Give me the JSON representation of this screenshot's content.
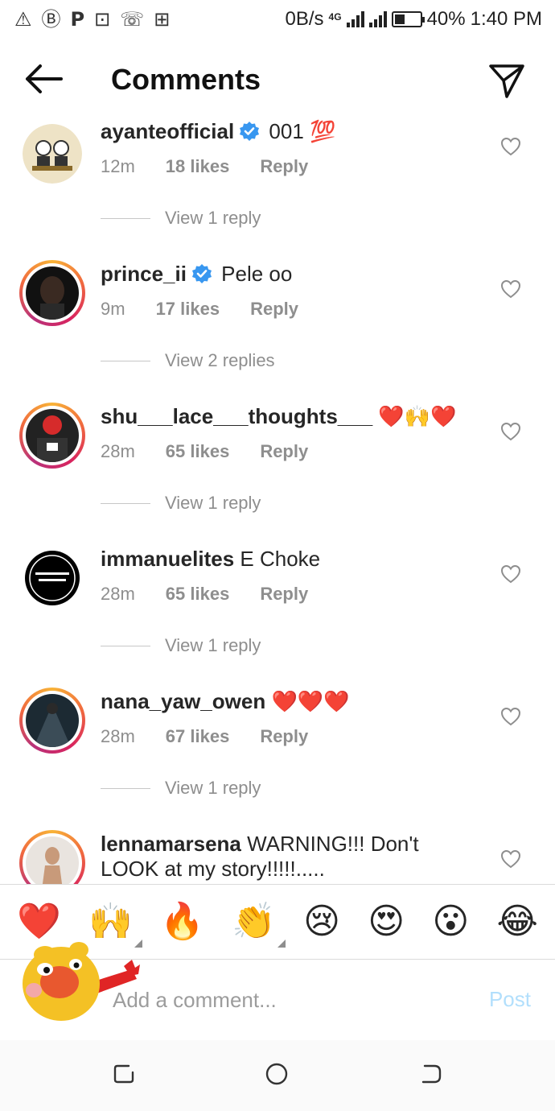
{
  "status_bar": {
    "left_icons": [
      "⚠",
      "Ⓑ",
      "P",
      "⊡",
      "☏",
      "⊞"
    ],
    "net_speed": "0B/s",
    "network_type": "4G",
    "battery": "40%",
    "battery_level": 0.4,
    "time": "1:40 PM"
  },
  "header": {
    "title": "Comments"
  },
  "comments": [
    {
      "username": "ayanteofficial",
      "verified": true,
      "text": "001 💯",
      "time": "12m",
      "likes": "18 likes",
      "reply_label": "Reply",
      "view_replies": "View 1 reply",
      "story_ring": false
    },
    {
      "username": "prince_ii",
      "verified": true,
      "text": "Pele oo",
      "time": "9m",
      "likes": "17 likes",
      "reply_label": "Reply",
      "view_replies": "View 2 replies",
      "story_ring": true
    },
    {
      "username": "shu___lace___thoughts___",
      "verified": false,
      "text": "❤️🙌❤️",
      "time": "28m",
      "likes": "65 likes",
      "reply_label": "Reply",
      "view_replies": "View 1 reply",
      "story_ring": true
    },
    {
      "username": "immanuelites",
      "verified": false,
      "text": "E Choke",
      "time": "28m",
      "likes": "65 likes",
      "reply_label": "Reply",
      "view_replies": "View 1 reply",
      "story_ring": false
    },
    {
      "username": "nana_yaw_owen",
      "verified": false,
      "text": "❤️❤️❤️",
      "time": "28m",
      "likes": "67 likes",
      "reply_label": "Reply",
      "view_replies": "View 1 reply",
      "story_ring": true
    },
    {
      "username": "lennamarsena",
      "verified": false,
      "text": "WARNING!!! Don't LOOK at my story!!!!!.....",
      "story_ring": true
    }
  ],
  "emoji_bar": [
    "❤️",
    "🙌",
    "🔥",
    "👏",
    "😢",
    "😍",
    "😮",
    "😂"
  ],
  "input": {
    "placeholder": "Add a comment...",
    "post_label": "Post"
  },
  "colors": {
    "text": "#262626",
    "secondary": "#8e8e8e",
    "verified_blue": "#3897f0",
    "post_disabled": "#b2dffc",
    "heart_red": "#ed4956"
  }
}
